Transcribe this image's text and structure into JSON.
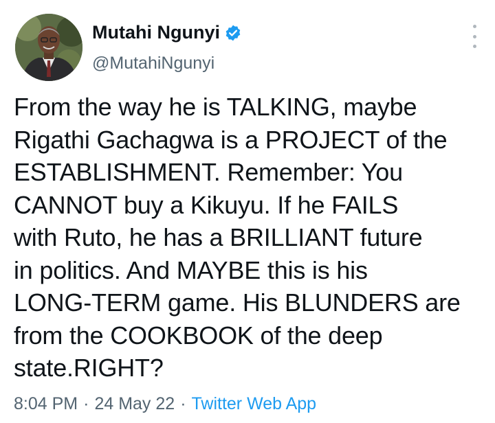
{
  "author": {
    "name": "Mutahi Ngunyi",
    "handle": "@MutahiNgunyi",
    "verified_color": "#1d9bf0"
  },
  "tweet": {
    "lines": [
      "From the way he is TALKING, maybe",
      "Rigathi Gachagwa is a PROJECT of the",
      "ESTABLISHMENT. Remember: You",
      "CANNOT buy a Kikuyu. If he FAILS",
      "with Ruto, he has a BRILLIANT future",
      "in politics. And MAYBE this is his",
      "LONG-TERM game. His BLUNDERS are",
      "from the COOKBOOK of the deep",
      "state.RIGHT?"
    ],
    "time": "8:04 PM",
    "separator": "·",
    "date": "24 May 22",
    "source": "Twitter Web App"
  },
  "icons": {
    "more": "more-options-icon",
    "verified": "verified-badge-icon"
  }
}
